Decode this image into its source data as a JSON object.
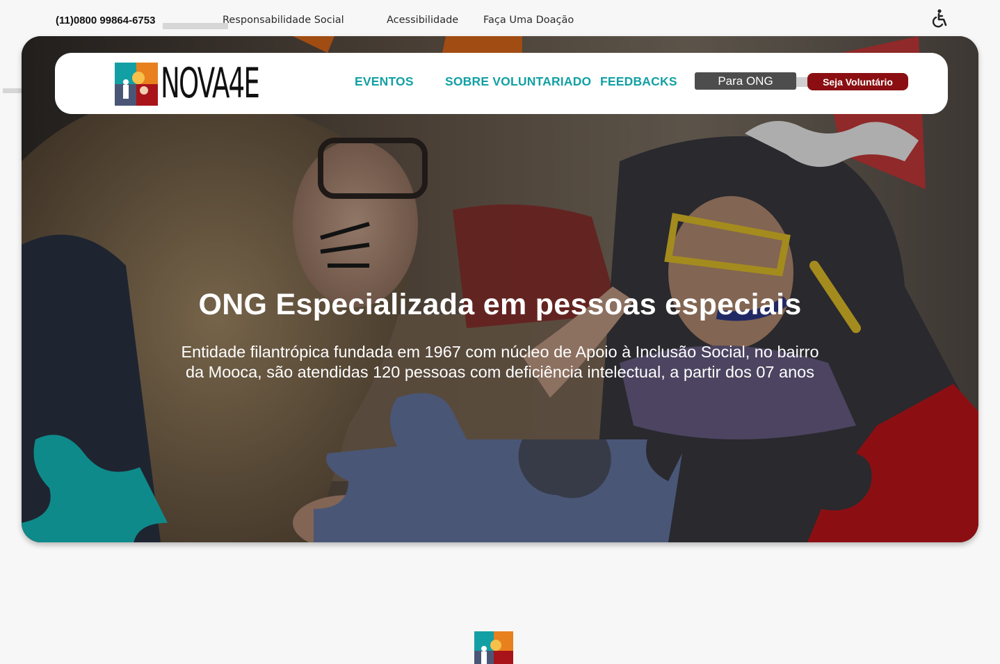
{
  "topbar": {
    "phone": "(11)0800 99864-6753",
    "links": [
      "Responsabilidade Social",
      "Acessibilidade",
      "Faça Uma Doação"
    ],
    "accessibility_icon": "wheelchair-icon"
  },
  "nav": {
    "logo_text": "NOVA4E",
    "links": [
      "EVENTOS",
      "SOBRE VOLUNTARIADO",
      "FEEDBACKS"
    ],
    "btn_ong": "Para ONG",
    "btn_volunteer": "Seja Voluntário"
  },
  "hero": {
    "title": "ONG Especializada em pessoas especiais",
    "subtitle": "Entidade filantrópica fundada em 1967 com núcleo de Apoio à Inclusão Social, no bairro da Mooca, são atendidas 120 pessoas com deficiência intelectual, a partir dos 07 anos"
  },
  "colors": {
    "teal": "#13a0a4",
    "dark_red": "#8b0f12",
    "slate_blue": "#4a5676",
    "puzzle_teal": "#0e8a8a",
    "button_gray": "#4d4d4d"
  }
}
